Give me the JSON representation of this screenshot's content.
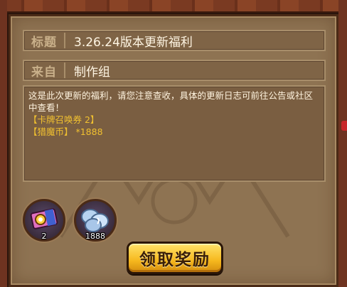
{
  "mail": {
    "title_label": "标题",
    "title_value": "3.26.24版本更新福利",
    "from_label": "来自",
    "from_value": "制作组",
    "body_text": "这是此次更新的福利，请您注意查收，具体的更新日志可前往公告或社区中查看！",
    "reward_line_1": "【卡牌召唤券 2】",
    "reward_line_2": "【猎魔币】 *1888"
  },
  "rewards": [
    {
      "icon": "card-summon-ticket-icon",
      "count": "2"
    },
    {
      "icon": "demon-hunter-coin-icon",
      "count": "1888"
    }
  ],
  "claim_button": {
    "label": "领取奖励"
  },
  "colors": {
    "panel": "#8e7352",
    "text_highlight": "#f0c030",
    "button": "#f6b81e"
  }
}
